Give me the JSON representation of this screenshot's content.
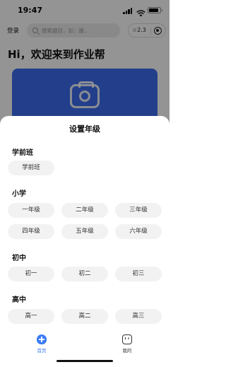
{
  "status_bar": {
    "time": "19:47"
  },
  "topbar": {
    "login_label": "登录",
    "search_placeholder": "搜索题目，如：撤...",
    "star_count": "☆2.3"
  },
  "main": {
    "greeting": "Hi，欢迎来到作业帮"
  },
  "sheet": {
    "title": "设置年级",
    "sections": [
      {
        "title": "学前班",
        "grades": [
          "学前班"
        ]
      },
      {
        "title": "小学",
        "grades": [
          "一年级",
          "二年级",
          "三年级",
          "四年级",
          "五年级",
          "六年级"
        ]
      },
      {
        "title": "初中",
        "grades": [
          "初一",
          "初二",
          "初三"
        ]
      },
      {
        "title": "高中",
        "grades": [
          "高一",
          "高二",
          "高三"
        ]
      }
    ]
  },
  "tabbar": {
    "home_label": "首页",
    "mine_label": "我的"
  },
  "colors": {
    "accent": "#3b7cf5",
    "banner": "#3d6df0"
  }
}
